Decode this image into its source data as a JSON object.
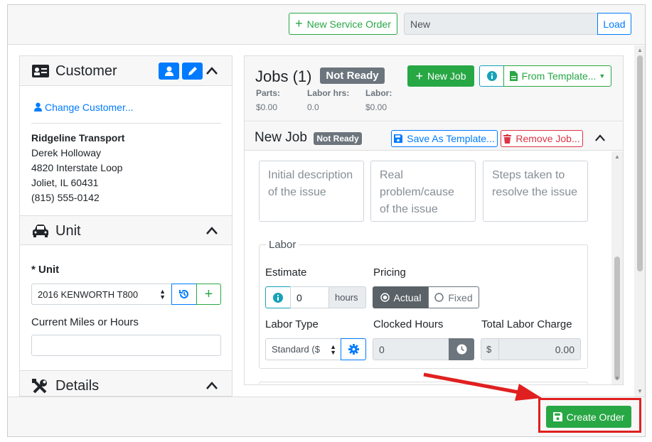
{
  "toolbar": {
    "new_service_order_label": "New Service Order",
    "order_input_value": "New",
    "load_label": "Load"
  },
  "customer": {
    "title": "Customer",
    "change_customer_label": "Change Customer...",
    "company": "Ridgeline Transport",
    "contact": "Derek Holloway",
    "address1": "4820 Interstate Loop",
    "address2": "Joliet, IL 60431",
    "phone": "(815) 555-0142"
  },
  "unit": {
    "title": "Unit",
    "unit_label": "* Unit",
    "unit_value": "2016 KENWORTH T800",
    "miles_label": "Current Miles or Hours",
    "miles_value": ""
  },
  "details": {
    "title": "Details"
  },
  "jobs": {
    "title": "Jobs (1)",
    "status_badge": "Not Ready",
    "new_job_label": "New Job",
    "from_template_label": "From Template...",
    "parts_label": "Parts:",
    "parts_value": "$0.00",
    "labor_hrs_label": "Labor hrs:",
    "labor_hrs_value": "0.0",
    "labor_label": "Labor:",
    "labor_value": "$0.00"
  },
  "job": {
    "title": "New Job",
    "status_badge": "Not Ready",
    "save_template_label": "Save As Template...",
    "remove_job_label": "Remove Job...",
    "complaint_placeholder": "Initial description of the issue",
    "cause_placeholder": "Real problem/cause of the issue",
    "correction_placeholder": "Steps taken to resolve the issue"
  },
  "labor": {
    "legend": "Labor",
    "estimate_label": "Estimate",
    "estimate_value": "0",
    "hours_label": "hours",
    "pricing_label": "Pricing",
    "actual_label": "Actual",
    "fixed_label": "Fixed",
    "labor_type_label": "Labor Type",
    "labor_type_value": "Standard ($",
    "clocked_hours_label": "Clocked Hours",
    "clocked_hours_value": "0",
    "total_labor_label": "Total Labor Charge",
    "currency_symbol": "$",
    "total_labor_value": "0.00"
  },
  "footer": {
    "create_order_label": "Create Order"
  },
  "colors": {
    "success": "#28a745",
    "primary": "#007bff",
    "info": "#17a2b8",
    "danger": "#dc3545",
    "highlight": "#e02020"
  }
}
